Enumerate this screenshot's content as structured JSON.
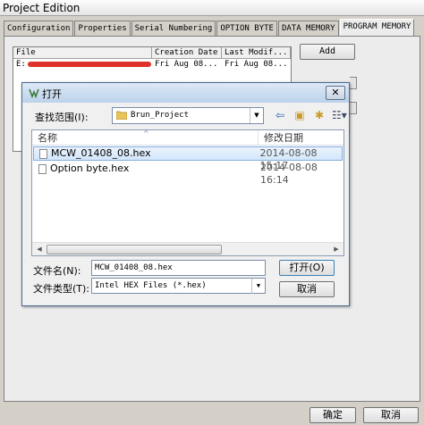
{
  "window": {
    "title": "Project Edition"
  },
  "tabs": [
    {
      "label": "Configuration"
    },
    {
      "label": "Properties"
    },
    {
      "label": "Serial Numbering"
    },
    {
      "label": "OPTION BYTE"
    },
    {
      "label": "DATA MEMORY"
    },
    {
      "label": "PROGRAM MEMORY"
    }
  ],
  "file_list": {
    "columns": [
      "File",
      "Creation Date",
      "Last Modif..."
    ],
    "rows": [
      {
        "file": "E:",
        "creation": "Fri Aug 08...",
        "modified": "Fri Aug 08..."
      }
    ]
  },
  "buttons": {
    "add": "Add",
    "ok": "确定",
    "cancel": "取消"
  },
  "dialog": {
    "title": "打开",
    "look_in_label": "查找范围(I):",
    "look_in_value": "Brun_Project",
    "list_headers": {
      "name": "名称",
      "date": "修改日期"
    },
    "files": [
      {
        "name": "MCW_01408_08.hex",
        "date": "2014-08-08 15:17"
      },
      {
        "name": "Option byte.hex",
        "date": "2014-08-08 16:14"
      }
    ],
    "filename_label": "文件名(N):",
    "filename_value": "MCW_01408_08.hex",
    "filetype_label": "文件类型(T):",
    "filetype_value": "Intel HEX Files (*.hex)",
    "open_button": "打开(O)",
    "cancel_button": "取消"
  },
  "colors": {
    "selection": "#d4e7fb",
    "redaction": "#e0302a"
  }
}
